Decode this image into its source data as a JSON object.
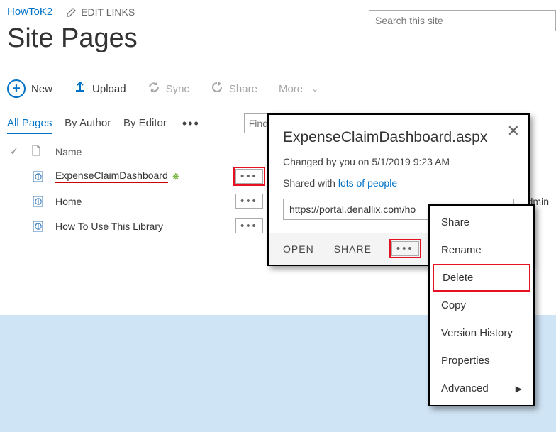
{
  "breadcrumb": {
    "site_link": "HowToK2",
    "edit_links_label": "EDIT LINKS"
  },
  "search": {
    "placeholder": "Search this site"
  },
  "page_title": "Site Pages",
  "toolbar": {
    "new_label": "New",
    "upload_label": "Upload",
    "sync_label": "Sync",
    "share_label": "Share",
    "more_label": "More"
  },
  "views": {
    "tabs": [
      "All Pages",
      "By Author",
      "By Editor"
    ],
    "find_placeholder": "Find a file"
  },
  "list": {
    "header_name": "Name",
    "items": [
      {
        "title": "ExpenseClaimDashboard",
        "is_new": true,
        "trailing": "",
        "highlighted": true,
        "ell_red": true
      },
      {
        "title": "Home",
        "is_new": false,
        "trailing": "Admin",
        "highlighted": false,
        "ell_red": false
      },
      {
        "title": "How To Use This Library",
        "is_new": false,
        "trailing": "",
        "highlighted": false,
        "ell_red": false
      }
    ]
  },
  "callout": {
    "title": "ExpenseClaimDashboard.aspx",
    "changed_by_text": "Changed by you on 5/1/2019 9:23 AM",
    "shared_prefix": "Shared with ",
    "shared_link": "lots of people",
    "url_value": "https://portal.denallix.com/ho",
    "open_label": "OPEN",
    "share_label": "SHARE"
  },
  "context_menu": {
    "items": [
      "Share",
      "Rename",
      "Delete",
      "Copy",
      "Version History",
      "Properties",
      "Advanced"
    ],
    "highlighted_index": 2,
    "submenu_index": 6
  }
}
